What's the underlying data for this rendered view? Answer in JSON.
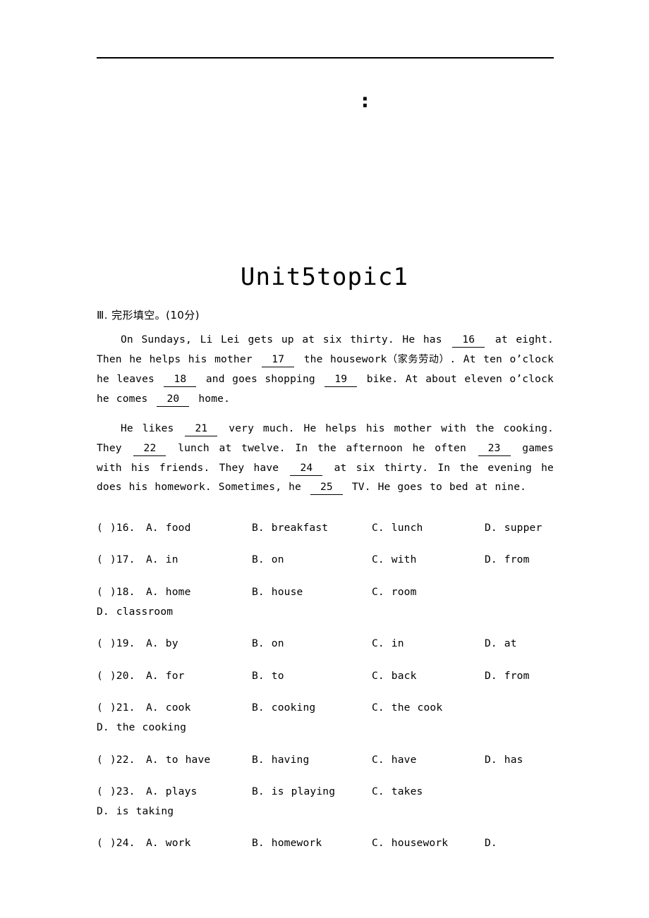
{
  "document": {
    "title": "Unit5topic1",
    "header_mark": ":",
    "section_heading": "Ⅲ. 完形填空。(10分)"
  },
  "passage": {
    "paragraphs": [
      {
        "id": "paragraph-1",
        "runs": [
          {
            "type": "indent"
          },
          {
            "type": "text",
            "text": "On Sundays, Li Lei gets up at six thirty. He has "
          },
          {
            "type": "blank",
            "text": "16"
          },
          {
            "type": "text",
            "text": " at eight. Then he helps his mother "
          },
          {
            "type": "blank",
            "text": "17"
          },
          {
            "type": "text",
            "text": " the housework"
          },
          {
            "type": "cn",
            "text": "（家务劳动）"
          },
          {
            "type": "text",
            "text": ". At ten o’clock he leaves "
          },
          {
            "type": "blank",
            "text": "18"
          },
          {
            "type": "text",
            "text": " and goes shopping "
          },
          {
            "type": "blank",
            "text": "19"
          },
          {
            "type": "text",
            "text": " bike. At about eleven o’clock he comes "
          },
          {
            "type": "blank",
            "text": "20"
          },
          {
            "type": "text",
            "text": " home."
          }
        ]
      },
      {
        "id": "paragraph-2",
        "runs": [
          {
            "type": "indent"
          },
          {
            "type": "text",
            "text": "He likes "
          },
          {
            "type": "blank",
            "text": "21"
          },
          {
            "type": "text",
            "text": " very much. He helps his mother with the cooking. They "
          },
          {
            "type": "blank",
            "text": "22"
          },
          {
            "type": "text",
            "text": " lunch at twelve. In the afternoon he often "
          },
          {
            "type": "blank",
            "text": "23"
          },
          {
            "type": "text",
            "text": " games with his friends. They have "
          },
          {
            "type": "blank",
            "text": "24"
          },
          {
            "type": "text",
            "text": " at six thirty. In the evening he does his homework. Sometimes, he "
          },
          {
            "type": "blank",
            "text": "25"
          },
          {
            "type": "text",
            "text": " TV. He goes to bed at nine."
          }
        ]
      }
    ]
  },
  "questions": [
    {
      "tag": "(  )16.",
      "options": [
        {
          "label": "A.",
          "text": "food"
        },
        {
          "label": "B.",
          "text": "breakfast"
        },
        {
          "label": "C.",
          "text": "lunch"
        },
        {
          "label": "D.",
          "text": "supper"
        }
      ]
    },
    {
      "tag": "(  )17.",
      "options": [
        {
          "label": "A.",
          "text": "in"
        },
        {
          "label": "B.",
          "text": "on"
        },
        {
          "label": "C.",
          "text": "with"
        },
        {
          "label": "D.",
          "text": "from"
        }
      ]
    },
    {
      "tag": "(  )18.",
      "options": [
        {
          "label": "A.",
          "text": "home"
        },
        {
          "label": "B.",
          "text": "house"
        },
        {
          "label": "C.",
          "text": "room"
        },
        {
          "label": "D.",
          "text": "classroom"
        }
      ]
    },
    {
      "tag": "(  )19.",
      "options": [
        {
          "label": "A.",
          "text": "by"
        },
        {
          "label": "B.",
          "text": "on"
        },
        {
          "label": "C.",
          "text": "in"
        },
        {
          "label": "D.",
          "text": "at"
        }
      ]
    },
    {
      "tag": "(  )20.",
      "options": [
        {
          "label": "A.",
          "text": "for"
        },
        {
          "label": "B.",
          "text": "to"
        },
        {
          "label": "C.",
          "text": "back"
        },
        {
          "label": "D.",
          "text": "from"
        }
      ]
    },
    {
      "tag": "(  )21.",
      "options": [
        {
          "label": "A.",
          "text": "cook"
        },
        {
          "label": "B.",
          "text": "cooking"
        },
        {
          "label": "C.",
          "text": "the cook"
        },
        {
          "label": "D.",
          "text": "the cooking"
        }
      ]
    },
    {
      "tag": "(  )22.",
      "options": [
        {
          "label": "A.",
          "text": "to have"
        },
        {
          "label": "B.",
          "text": "having"
        },
        {
          "label": "C.",
          "text": "have"
        },
        {
          "label": "D.",
          "text": "has"
        }
      ]
    },
    {
      "tag": "(  )23.",
      "options": [
        {
          "label": "A.",
          "text": "plays"
        },
        {
          "label": "B.",
          "text": "is playing"
        },
        {
          "label": "C.",
          "text": "takes"
        },
        {
          "label": "D.",
          "text": "is taking"
        }
      ]
    },
    {
      "tag": "(  )24.",
      "options": [
        {
          "label": "A.",
          "text": "work"
        },
        {
          "label": "B.",
          "text": "homework"
        },
        {
          "label": "C.",
          "text": "housework"
        },
        {
          "label": "D.",
          "text": ""
        }
      ]
    }
  ]
}
